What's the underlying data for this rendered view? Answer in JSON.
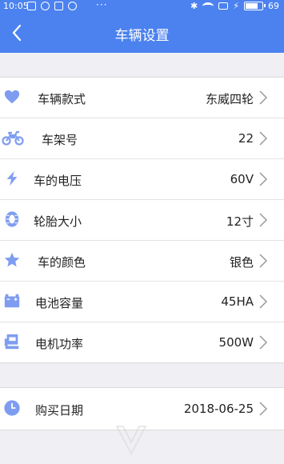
{
  "status_bar": {
    "time": "10:05",
    "dots": "···",
    "bluetooth": "✱",
    "charging": "⚡",
    "battery_level": "69",
    "battery_fraction": 0.69
  },
  "header": {
    "title": "车辆设置",
    "back_icon": "back-chevron-icon"
  },
  "vehicle_settings": {
    "items": [
      {
        "label": "车辆款式",
        "value": "东威四轮",
        "icon": "heart-icon"
      },
      {
        "label": "车架号",
        "value": "22",
        "icon": "motorcycle-icon"
      },
      {
        "label": "车的电压",
        "value": "60V",
        "icon": "lightning-icon"
      },
      {
        "label": "轮胎大小",
        "value": "12寸",
        "icon": "tire-icon"
      },
      {
        "label": "车的颜色",
        "value": "银色",
        "icon": "star-icon"
      },
      {
        "label": "电池容量",
        "value": "45HA",
        "icon": "battery-icon"
      },
      {
        "label": "电机功率",
        "value": "500W",
        "icon": "motor-icon"
      }
    ]
  },
  "purchase": {
    "label": "购买日期",
    "value": "2018-06-25",
    "icon": "clock-icon"
  },
  "colors": {
    "primary": "#4c82ef",
    "icon": "#7f9df0",
    "background": "#efeff4"
  }
}
